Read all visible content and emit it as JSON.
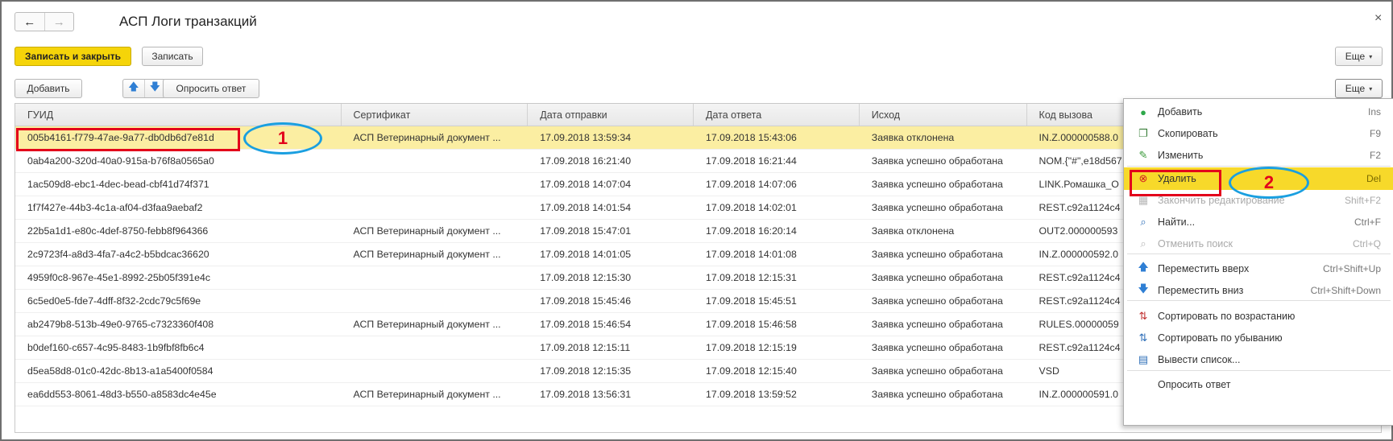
{
  "window": {
    "title": "АСП Логи транзакций",
    "back": "←",
    "forward": "→",
    "close": "×"
  },
  "toolbar": {
    "save_close": "Записать и закрыть",
    "save": "Записать",
    "more_top": "Еще",
    "add": "Добавить",
    "move_up": "🡅",
    "move_down": "🡇",
    "ask_answer": "Опросить ответ",
    "more": "Еще",
    "caret": "▾"
  },
  "table": {
    "headers": [
      "ГУИД",
      "Сертификат",
      "Дата отправки",
      "Дата ответа",
      "Исход",
      "Код вызова"
    ],
    "rows": [
      [
        "005b4161-f779-47ae-9a77-db0db6d7e81d",
        "АСП Ветеринарный документ ...",
        "17.09.2018 13:59:34",
        "17.09.2018 15:43:06",
        "Заявка отклонена",
        "IN.Z.000000588.0"
      ],
      [
        "0ab4a200-320d-40a0-915a-b76f8a0565a0",
        "",
        "17.09.2018 16:21:40",
        "17.09.2018 16:21:44",
        "Заявка успешно обработана",
        "NOM.{\"#\",e18d567"
      ],
      [
        "1ac509d8-ebc1-4dec-bead-cbf41d74f371",
        "",
        "17.09.2018 14:07:04",
        "17.09.2018 14:07:06",
        "Заявка успешно обработана",
        "LINK.Ромашка_О"
      ],
      [
        "1f7f427e-44b3-4c1a-af04-d3faa9aebaf2",
        "",
        "17.09.2018 14:01:54",
        "17.09.2018 14:02:01",
        "Заявка успешно обработана",
        "REST.c92a1124c4"
      ],
      [
        "22b5a1d1-e80c-4def-8750-febb8f964366",
        "АСП Ветеринарный документ ...",
        "17.09.2018 15:47:01",
        "17.09.2018 16:20:14",
        "Заявка отклонена",
        "OUT2.000000593"
      ],
      [
        "2c9723f4-a8d3-4fa7-a4c2-b5bdcac36620",
        "АСП Ветеринарный документ ...",
        "17.09.2018 14:01:05",
        "17.09.2018 14:01:08",
        "Заявка успешно обработана",
        "IN.Z.000000592.0"
      ],
      [
        "4959f0c8-967e-45e1-8992-25b05f391e4c",
        "",
        "17.09.2018 12:15:30",
        "17.09.2018 12:15:31",
        "Заявка успешно обработана",
        "REST.c92a1124c4"
      ],
      [
        "6c5ed0e5-fde7-4dff-8f32-2cdc79c5f69e",
        "",
        "17.09.2018 15:45:46",
        "17.09.2018 15:45:51",
        "Заявка успешно обработана",
        "REST.c92a1124c4"
      ],
      [
        "ab2479b8-513b-49e0-9765-c7323360f408",
        "АСП Ветеринарный документ ...",
        "17.09.2018 15:46:54",
        "17.09.2018 15:46:58",
        "Заявка успешно обработана",
        "RULES.00000059"
      ],
      [
        "b0def160-c657-4c95-8483-1b9fbf8fb6c4",
        "",
        "17.09.2018 12:15:11",
        "17.09.2018 12:15:19",
        "Заявка успешно обработана",
        "REST.c92a1124c4"
      ],
      [
        "d5ea58d8-01c0-42dc-8b13-a1a5400f0584",
        "",
        "17.09.2018 12:15:35",
        "17.09.2018 12:15:40",
        "Заявка успешно обработана",
        "VSD"
      ],
      [
        "ea6dd553-8061-48d3-b550-a8583dc4e45e",
        "АСП Ветеринарный документ ...",
        "17.09.2018 13:56:31",
        "17.09.2018 13:59:52",
        "Заявка успешно обработана",
        "IN.Z.000000591.0"
      ]
    ]
  },
  "menu": {
    "items": [
      {
        "label": "Добавить",
        "shortcut": "Ins",
        "icon": "add-icon"
      },
      {
        "label": "Скопировать",
        "shortcut": "F9",
        "icon": "copy-icon"
      },
      {
        "label": "Изменить",
        "shortcut": "F2",
        "icon": "edit-icon"
      },
      {
        "label": "Удалить",
        "shortcut": "Del",
        "icon": "delete-icon"
      },
      {
        "label": "Закончить редактирование",
        "shortcut": "Shift+F2",
        "icon": "end-edit-icon"
      },
      {
        "label": "Найти...",
        "shortcut": "Ctrl+F",
        "icon": "find-icon"
      },
      {
        "label": "Отменить поиск",
        "shortcut": "Ctrl+Q",
        "icon": "cancel-search-icon"
      },
      {
        "label": "Переместить вверх",
        "shortcut": "Ctrl+Shift+Up",
        "icon": "arrow-up-icon"
      },
      {
        "label": "Переместить вниз",
        "shortcut": "Ctrl+Shift+Down",
        "icon": "arrow-down-icon"
      },
      {
        "label": "Сортировать по возрастанию",
        "shortcut": "",
        "icon": "sort-asc-icon"
      },
      {
        "label": "Сортировать по убыванию",
        "shortcut": "",
        "icon": "sort-desc-icon"
      },
      {
        "label": "Вывести список...",
        "shortcut": "",
        "icon": "print-list-icon"
      },
      {
        "label": "Опросить ответ",
        "shortcut": "",
        "icon": ""
      }
    ]
  },
  "annotations": {
    "one": "1",
    "two": "2"
  },
  "colors": {
    "accent": "#f5d409",
    "selected_row": "#fbeea2",
    "highlight": "#f7d92a",
    "marker_red": "#e3001b",
    "marker_blue": "#1a9fe0"
  }
}
